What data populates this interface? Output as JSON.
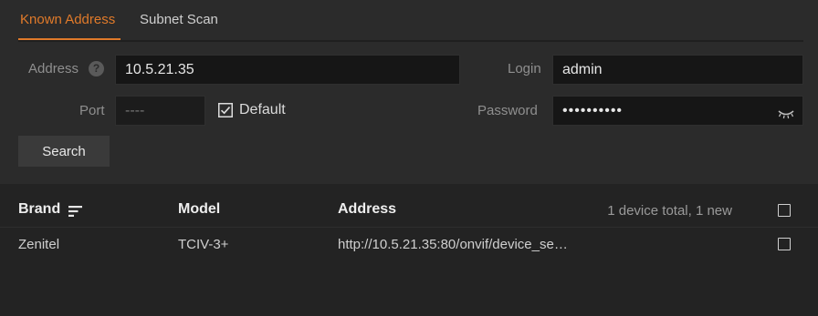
{
  "tabs": [
    {
      "label": "Known Address",
      "active": true
    },
    {
      "label": "Subnet Scan",
      "active": false
    }
  ],
  "form": {
    "address_label": "Address",
    "address_value": "10.5.21.35",
    "port_label": "Port",
    "port_placeholder": "----",
    "default_label": "Default",
    "default_checked": true,
    "login_label": "Login",
    "login_value": "admin",
    "password_label": "Password",
    "password_value": "••••••••••",
    "search_label": "Search"
  },
  "table": {
    "columns": [
      "Brand",
      "Model",
      "Address"
    ],
    "summary": "1 device total, 1 new",
    "rows": [
      {
        "brand": "Zenitel",
        "model": "TCIV-3+",
        "address": "http://10.5.21.35:80/onvif/device_se…"
      }
    ]
  },
  "colors": {
    "accent": "#e07a2a",
    "background": "#2b2b2b",
    "input_bg": "#161616"
  },
  "icons": [
    "help-icon",
    "checkbox-checked-icon",
    "eye-closed-icon",
    "sort-icon",
    "checkbox-icon"
  ]
}
